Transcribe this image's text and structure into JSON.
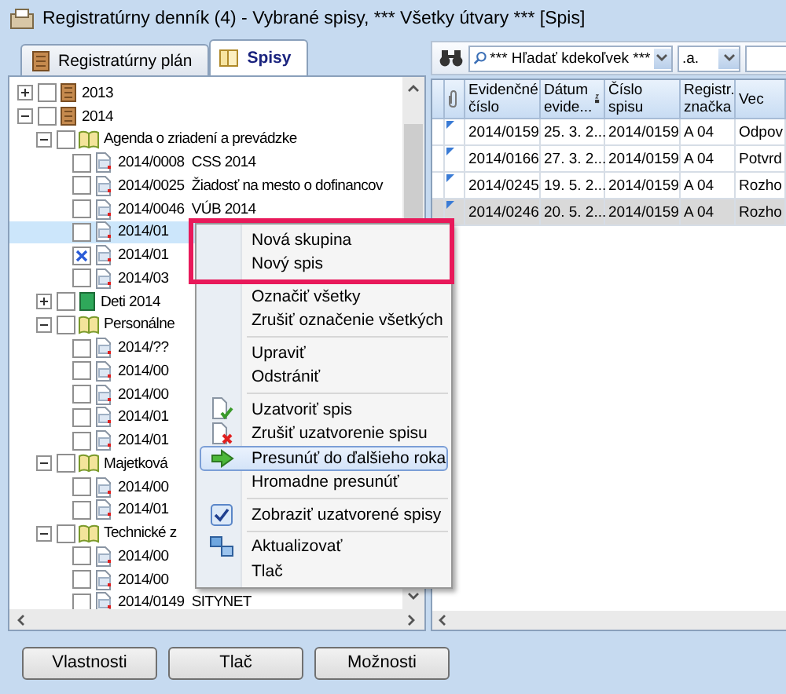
{
  "window": {
    "title": "Registratúrny denník (4) - Vybrané spisy, *** Všetky útvary *** [Spis]"
  },
  "tabs": [
    {
      "label": "Registratúrny plán",
      "selected": false
    },
    {
      "label": "Spisy",
      "selected": true
    }
  ],
  "tree": [
    {
      "label": "2013",
      "kind": "year",
      "expanded": false,
      "checked": false,
      "selected": false
    },
    {
      "label": "2014",
      "kind": "year",
      "expanded": true,
      "checked": false,
      "selected": false,
      "children": [
        {
          "label": "Agenda o zriadení a prevádzke",
          "kind": "book",
          "expanded": true,
          "checked": false,
          "selected": false,
          "children": [
            {
              "label": "2014/0008  CSS 2014",
              "kind": "file",
              "checked": false,
              "selected": false
            },
            {
              "label": "2014/0025  Žiadosť na mesto o dofinancov",
              "kind": "file",
              "checked": false,
              "selected": false
            },
            {
              "label": "2014/0046  VÚB 2014",
              "kind": "file",
              "checked": false,
              "selected": false
            },
            {
              "label": "2014/01",
              "kind": "file",
              "checked": false,
              "selected": true
            },
            {
              "label": "2014/01",
              "kind": "file",
              "checked": true,
              "selected": false
            },
            {
              "label": "2014/03",
              "kind": "file",
              "checked": false,
              "selected": false
            }
          ]
        },
        {
          "label": "Deti 2014",
          "kind": "binder",
          "expanded": false,
          "checked": false,
          "selected": false
        },
        {
          "label": "Personálne",
          "kind": "book",
          "expanded": true,
          "checked": false,
          "selected": false,
          "children": [
            {
              "label": "2014/??",
              "kind": "file",
              "checked": false,
              "selected": false
            },
            {
              "label": "2014/00",
              "kind": "file",
              "checked": false,
              "selected": false
            },
            {
              "label": "2014/00",
              "kind": "file",
              "checked": false,
              "selected": false
            },
            {
              "label": "2014/01",
              "kind": "file",
              "checked": false,
              "selected": false
            },
            {
              "label": "2014/01",
              "kind": "file",
              "checked": false,
              "selected": false
            }
          ]
        },
        {
          "label": "Majetková",
          "kind": "book",
          "expanded": true,
          "checked": false,
          "selected": false,
          "children": [
            {
              "label": "2014/00",
              "kind": "file",
              "checked": false,
              "selected": false
            },
            {
              "label": "2014/01",
              "kind": "file",
              "checked": false,
              "selected": false
            }
          ]
        },
        {
          "label": "Technické z",
          "kind": "book",
          "expanded": true,
          "checked": false,
          "selected": false,
          "children": [
            {
              "label": "2014/00",
              "kind": "file",
              "checked": false,
              "selected": false
            },
            {
              "label": "2014/00",
              "kind": "file",
              "checked": false,
              "selected": false
            },
            {
              "label": "2014/0149  SITYNET",
              "kind": "file",
              "checked": false,
              "selected": false
            }
          ]
        }
      ]
    }
  ],
  "toolbar": {
    "search": "*** Hľadať kdekoľvek ***",
    "filter": ".a."
  },
  "table": {
    "columns": [
      "Evidenčné číslo",
      "Dátum evide...",
      "Číslo spisu",
      "Registr. značka",
      "Vec"
    ],
    "rows": [
      {
        "cells": [
          "2014/0159",
          "25. 3. 2...",
          "2014/0159",
          "A 04",
          "Odpov"
        ],
        "selected": false
      },
      {
        "cells": [
          "2014/0166",
          "27. 3. 2...",
          "2014/0159",
          "A 04",
          "Potvrd"
        ],
        "selected": false
      },
      {
        "cells": [
          "2014/0245",
          "19. 5. 2...",
          "2014/0159",
          "A 04",
          "Rozho"
        ],
        "selected": false
      },
      {
        "cells": [
          "2014/0246",
          "20. 5. 2...",
          "2014/0159",
          "A 04",
          "Rozho"
        ],
        "selected": true
      }
    ]
  },
  "context_menu": [
    {
      "kind": "item",
      "label": "Nová skupina",
      "selected": false
    },
    {
      "kind": "item",
      "label": "Nový spis",
      "selected": false
    },
    {
      "kind": "separator"
    },
    {
      "kind": "item",
      "label": "Označiť všetky",
      "selected": false
    },
    {
      "kind": "item",
      "label": "Zrušiť označenie všetkých",
      "selected": false
    },
    {
      "kind": "separator"
    },
    {
      "kind": "item",
      "label": "Upraviť",
      "selected": false
    },
    {
      "kind": "item",
      "label": "Odstrániť",
      "selected": false
    },
    {
      "kind": "separator"
    },
    {
      "kind": "item",
      "label": "Uzatvoriť spis",
      "selected": false
    },
    {
      "kind": "item",
      "label": "Zrušiť uzatvorenie spisu",
      "selected": false
    },
    {
      "kind": "item",
      "label": "Presunúť do ďalšieho roka",
      "selected": true
    },
    {
      "kind": "item",
      "label": "Hromadne presunúť",
      "selected": false
    },
    {
      "kind": "separator"
    },
    {
      "kind": "item",
      "label": "Zobraziť uzatvorené spisy",
      "selected": false,
      "checked": true
    },
    {
      "kind": "separator"
    },
    {
      "kind": "item",
      "label": "Aktualizovať",
      "selected": false
    },
    {
      "kind": "item",
      "label": "Tlač",
      "selected": false
    }
  ],
  "buttons": [
    "Vlastnosti",
    "Tlač",
    "Možnosti"
  ]
}
